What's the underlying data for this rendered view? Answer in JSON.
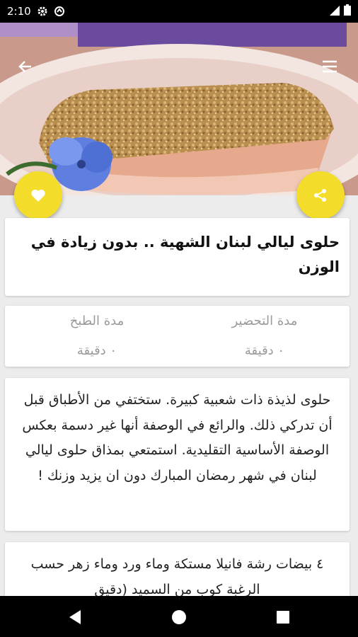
{
  "status_bar": {
    "time": "2:10",
    "icons": [
      "settings-icon",
      "sync-icon",
      "signal-icon",
      "battery-icon"
    ]
  },
  "header": {
    "back_icon": "arrow-left-icon",
    "menu_icon": "hamburger-menu-icon"
  },
  "actions": {
    "favorite_icon": "heart-icon",
    "share_icon": "share-icon",
    "fab_color": "#f3dd2a"
  },
  "recipe": {
    "title": "حلوى ليالي لبنان الشهية .. بدون زيادة في الوزن",
    "prep_label": "مدة التحضير",
    "prep_value": "٠ دقيقة",
    "cook_label": "مدة الطبخ",
    "cook_value": "٠ دقيقة",
    "description": "حلوى لذيذة ذات شعبية كبيرة. ستختفي من الأطباق قبل أن تدركي ذلك. والرائع في الوصفة أنها غير دسمة بعكس الوصفة الأساسية التقليدية. استمتعي بمذاق حلوى ليالي لبنان في شهر رمضان المبارك دون ان يزيد وزنك !",
    "ingredients": "٤ بيضات رشة فانيلا مستكة وماء ورد وماء زهر حسب الرغبة كوب من السميد (دقيق"
  },
  "nav_bar": {
    "icons": [
      "back-triangle-icon",
      "home-circle-icon",
      "recents-square-icon"
    ]
  }
}
